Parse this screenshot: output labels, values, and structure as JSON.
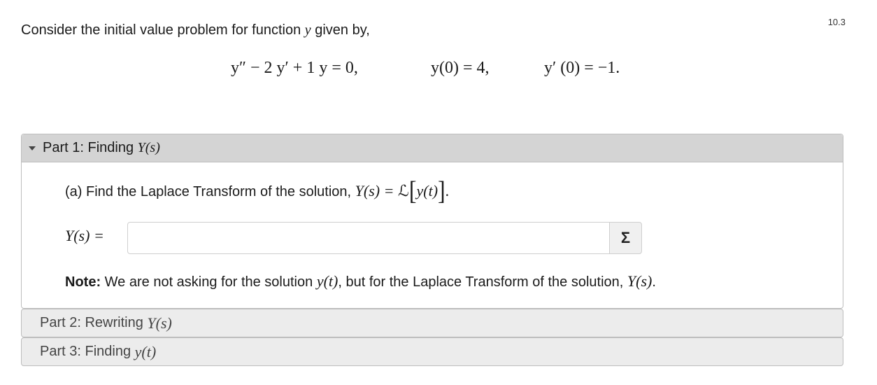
{
  "question_number": "10.3",
  "intro": {
    "text_before": "Consider the initial value problem for function",
    "variable": "y",
    "text_after": "given by,"
  },
  "equations": {
    "ode": "y″ − 2 y′ + 1 y = 0,",
    "ic1": "y(0) = 4,",
    "ic2": "y′ (0) = −1."
  },
  "part1": {
    "title_prefix": "Part 1: Finding",
    "title_math": "Y(s)",
    "question_text": "(a) Find the Laplace Transform of the solution,",
    "question_math_lhs": "Y(s) = ",
    "question_math_L": "ℒ",
    "question_math_arg": "y(t)",
    "question_end": ".",
    "answer_label": "Y(s) =",
    "answer_value": "",
    "equation_editor_symbol": "Σ",
    "note_label": "Note:",
    "note_text_1": " We are not asking for the solution ",
    "note_math_1": "y(t)",
    "note_text_2": ", but for the Laplace Transform of the solution, ",
    "note_math_2": "Y(s)",
    "note_end": "."
  },
  "part2": {
    "title_prefix": "Part 2: Rewriting",
    "title_math": "Y(s)"
  },
  "part3": {
    "title_prefix": "Part 3: Finding",
    "title_math": "y(t)"
  },
  "icons": {
    "expand": "caret-down-icon",
    "equation_editor": "sigma-icon"
  },
  "colors": {
    "header_bg": "#d4d4d4",
    "collapsed_bg": "#ececec",
    "border": "#bdbdbd"
  }
}
